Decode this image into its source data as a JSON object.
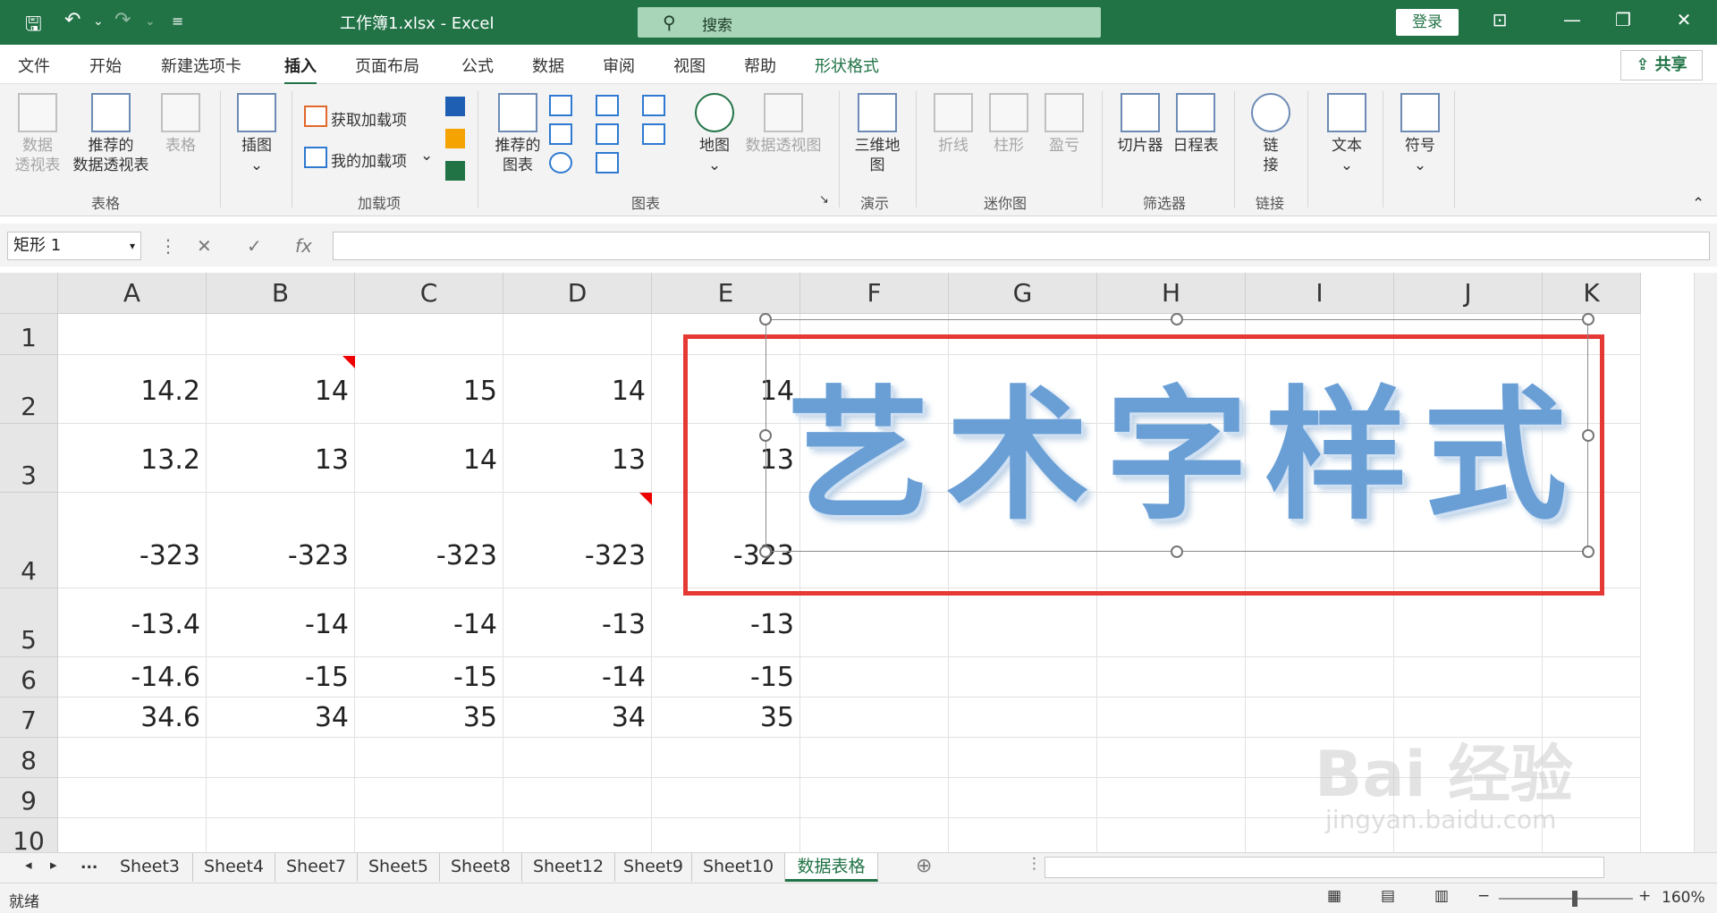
{
  "titlebar": {
    "file_title": "工作簿1.xlsx  -  Excel",
    "search_placeholder": "搜索",
    "login": "登录"
  },
  "menu": [
    "文件",
    "开始",
    "新建选项卡",
    "插入",
    "页面布局",
    "公式",
    "数据",
    "审阅",
    "视图",
    "帮助",
    "形状格式"
  ],
  "share": "共享",
  "ribbon": {
    "pivot": "数据\n透视表",
    "rec_pivot": "推荐的\n数据透视表",
    "table": "表格",
    "group_tables": "表格",
    "illustration": "插图",
    "get_addins": "获取加载项",
    "my_addins": "我的加载项",
    "group_addins": "加载项",
    "rec_charts": "推荐的\n图表",
    "map": "地图",
    "pivot_chart": "数据透视图",
    "group_charts": "图表",
    "map3d": "三维地\n图",
    "group_demo": "演示",
    "line": "折线",
    "column": "柱形",
    "winloss": "盈亏",
    "group_spark": "迷你图",
    "slicer": "切片器",
    "timeline": "日程表",
    "group_filter": "筛选器",
    "link": "链\n接",
    "group_link": "链接",
    "text": "文本",
    "symbol": "符号"
  },
  "namebox": "矩形 1",
  "columns": [
    "A",
    "B",
    "C",
    "D",
    "E",
    "F",
    "G",
    "H",
    "I",
    "J",
    "K"
  ],
  "rows": [
    "1",
    "2",
    "3",
    "4",
    "5",
    "6",
    "7",
    "8",
    "9",
    "10"
  ],
  "cells": [
    [
      "",
      "",
      "",
      "",
      ""
    ],
    [
      "14.2",
      "14",
      "15",
      "14",
      "14"
    ],
    [
      "13.2",
      "13",
      "14",
      "13",
      "13"
    ],
    [
      "-323",
      "-323",
      "-323",
      "-323",
      "-323"
    ],
    [
      "-13.4",
      "-14",
      "-14",
      "-13",
      "-13"
    ],
    [
      "-14.6",
      "-15",
      "-15",
      "-14",
      "-15"
    ],
    [
      "34.6",
      "34",
      "35",
      "34",
      "35"
    ]
  ],
  "wordart": "艺术字样式",
  "sheets": [
    "Sheet3",
    "Sheet4",
    "Sheet7",
    "Sheet5",
    "Sheet8",
    "Sheet12",
    "Sheet9",
    "Sheet10",
    "数据表格"
  ],
  "status": {
    "ready": "就绪",
    "zoom": "160%"
  },
  "watermark": "Bai 经验",
  "watermark_url": "jingyan.baidu.com"
}
